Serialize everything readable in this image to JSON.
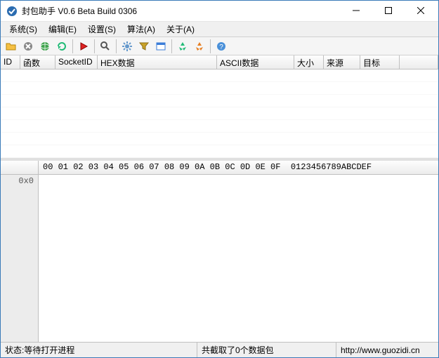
{
  "title": "封包助手 V0.6 Beta Build 0306",
  "menu": {
    "system": "系统(S)",
    "edit": "编辑(E)",
    "settings": "设置(S)",
    "algorithm": "算法(A)",
    "about": "关于(A)"
  },
  "columns": {
    "id": "ID",
    "func": "函数",
    "socketid": "SocketID",
    "hexdata": "HEX数据",
    "asciidata": "ASCII数据",
    "size": "大小",
    "source": "来源",
    "target": "目标"
  },
  "hex": {
    "ruler": "00 01 02 03 04 05 06 07 08 09 0A 0B 0C 0D 0E 0F  0123456789ABCDEF",
    "offset0": "0x0"
  },
  "status": {
    "state": "状态:等待打开进程",
    "count": "共截取了0个数据包",
    "url": "http://www.guozidi.cn"
  },
  "icons": {
    "open": "open-folder",
    "stop": "stop",
    "globe": "globe",
    "refresh": "refresh",
    "play": "play",
    "search": "search",
    "gear": "gear",
    "filter": "filter",
    "window": "window",
    "recycle-green": "recycle",
    "recycle-orange": "recycle-alt",
    "help": "help"
  }
}
